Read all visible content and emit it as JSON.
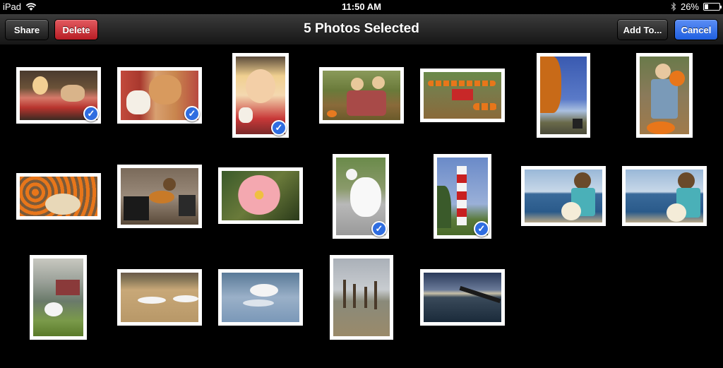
{
  "status_bar": {
    "device": "iPad",
    "wifi_icon": "wifi-icon",
    "time": "11:50 AM",
    "bluetooth_icon": "bluetooth-icon",
    "battery_percent": "26%",
    "battery_level": 0.26
  },
  "nav": {
    "share_label": "Share",
    "delete_label": "Delete",
    "title": "5 Photos Selected",
    "add_to_label": "Add To...",
    "cancel_label": "Cancel"
  },
  "colors": {
    "delete": "#c8262d",
    "cancel": "#2f6de0",
    "checkmark": "#2f6de0"
  },
  "photos": [
    {
      "subject": "girl-eating-ice-cream-with-dog",
      "selected": true
    },
    {
      "subject": "dog-licking-ice-cream",
      "selected": true
    },
    {
      "subject": "girl-with-ice-cream-portrait",
      "selected": true
    },
    {
      "subject": "family-at-pumpkin-patch",
      "selected": false
    },
    {
      "subject": "red-wagon-with-pumpkins",
      "selected": false
    },
    {
      "subject": "autumn-tree-and-sky",
      "selected": false
    },
    {
      "subject": "boy-holding-pumpkin",
      "selected": false
    },
    {
      "subject": "pumpkin-field",
      "selected": false
    },
    {
      "subject": "street-guitarist",
      "selected": false
    },
    {
      "subject": "pink-flower",
      "selected": false
    },
    {
      "subject": "white-goose",
      "selected": true
    },
    {
      "subject": "red-white-lighthouse",
      "selected": true
    },
    {
      "subject": "boy-on-beach-with-ball",
      "selected": false
    },
    {
      "subject": "boy-on-beach-with-ball-2",
      "selected": false
    },
    {
      "subject": "swan-by-farmhouse",
      "selected": false
    },
    {
      "subject": "swans-in-field",
      "selected": false
    },
    {
      "subject": "swans-landing-on-water",
      "selected": false
    },
    {
      "subject": "old-pier-posts",
      "selected": false
    },
    {
      "subject": "pier-at-sunset",
      "selected": false
    }
  ]
}
